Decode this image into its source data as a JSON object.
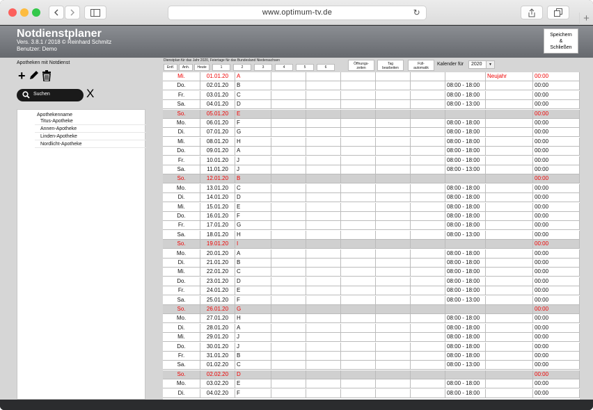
{
  "browser": {
    "url": "www.optimum-tv.de",
    "back_icon": "chevron-left-icon",
    "forward_icon": "chevron-right-icon",
    "sidebar_icon": "sidebar-icon",
    "share_icon": "share-icon",
    "tabs_icon": "tabs-icon",
    "reload_icon": "reload-icon",
    "new_tab_label": "+"
  },
  "app": {
    "title": "Notdienstplaner",
    "version": "Vers. 3.8.1 / 2018 © Reinhard Schmitz",
    "user": "Benutzer: Demo",
    "save_line1": "Speichern",
    "save_line2": "&",
    "save_line3": "Schließen"
  },
  "left": {
    "label": "Apotheken mit  Notdienst",
    "search_placeholder": "Suchen",
    "clear_label": "X",
    "column_header": "Apothekenname",
    "pharmacies": [
      "Titus-Apotheke",
      "Annen-Apotheke",
      "Linden-Apotheke",
      "Nordlicht-Apotheke"
    ]
  },
  "toolbar": {
    "title": "Dienstplan für das Jahr 2020, Feiertage für das Bundesland Niedersachsen",
    "buttons": [
      "Entf.",
      "Anh.",
      "Heute",
      "1",
      "2",
      "3",
      "4",
      "5",
      "6"
    ],
    "opening_line1": "Öffnungs-",
    "opening_line2": "zeiten",
    "edit_line1": "Tag",
    "edit_line2": "bearbeiten",
    "auto_line1": "Füll-",
    "auto_line2": "automatik",
    "calendar_label": "Kalender für",
    "year": "2020"
  },
  "colors": {
    "sunday_row": "#d0d0d0",
    "holiday_text": "#e00000",
    "header": "#7a7d82"
  },
  "rows": [
    {
      "day": "Mi.",
      "date": "01.01.20",
      "code": "A",
      "hours": "",
      "note": "Neujahr",
      "end": "00:00",
      "type": "holiday"
    },
    {
      "day": "Do.",
      "date": "02.01.20",
      "code": "B",
      "hours": "08:00 - 18:00",
      "note": "",
      "end": "00:00",
      "type": "normal"
    },
    {
      "day": "Fr.",
      "date": "03.01.20",
      "code": "C",
      "hours": "08:00 - 18:00",
      "note": "",
      "end": "00:00",
      "type": "normal"
    },
    {
      "day": "Sa.",
      "date": "04.01.20",
      "code": "D",
      "hours": "08:00 - 13:00",
      "note": "",
      "end": "00:00",
      "type": "normal"
    },
    {
      "day": "So.",
      "date": "05.01.20",
      "code": "E",
      "hours": "",
      "note": "",
      "end": "00:00",
      "type": "sunday"
    },
    {
      "day": "Mo.",
      "date": "06.01.20",
      "code": "F",
      "hours": "08:00 - 18:00",
      "note": "",
      "end": "00:00",
      "type": "normal"
    },
    {
      "day": "Di.",
      "date": "07.01.20",
      "code": "G",
      "hours": "08:00 - 18:00",
      "note": "",
      "end": "00:00",
      "type": "normal"
    },
    {
      "day": "Mi.",
      "date": "08.01.20",
      "code": "H",
      "hours": "08:00 - 18:00",
      "note": "",
      "end": "00:00",
      "type": "normal"
    },
    {
      "day": "Do.",
      "date": "09.01.20",
      "code": "A",
      "hours": "08:00 - 18:00",
      "note": "",
      "end": "00:00",
      "type": "normal"
    },
    {
      "day": "Fr.",
      "date": "10.01.20",
      "code": "J",
      "hours": "08:00 - 18:00",
      "note": "",
      "end": "00:00",
      "type": "normal"
    },
    {
      "day": "Sa.",
      "date": "11.01.20",
      "code": "J",
      "hours": "08:00 - 13:00",
      "note": "",
      "end": "00:00",
      "type": "normal"
    },
    {
      "day": "So.",
      "date": "12.01.20",
      "code": "B",
      "hours": "",
      "note": "",
      "end": "00:00",
      "type": "sunday"
    },
    {
      "day": "Mo.",
      "date": "13.01.20",
      "code": "C",
      "hours": "08:00 - 18:00",
      "note": "",
      "end": "00:00",
      "type": "normal"
    },
    {
      "day": "Di.",
      "date": "14.01.20",
      "code": "D",
      "hours": "08:00 - 18:00",
      "note": "",
      "end": "00:00",
      "type": "normal"
    },
    {
      "day": "Mi.",
      "date": "15.01.20",
      "code": "E",
      "hours": "08:00 - 18:00",
      "note": "",
      "end": "00:00",
      "type": "normal"
    },
    {
      "day": "Do.",
      "date": "16.01.20",
      "code": "F",
      "hours": "08:00 - 18:00",
      "note": "",
      "end": "00:00",
      "type": "normal"
    },
    {
      "day": "Fr.",
      "date": "17.01.20",
      "code": "G",
      "hours": "08:00 - 18:00",
      "note": "",
      "end": "00:00",
      "type": "normal"
    },
    {
      "day": "Sa.",
      "date": "18.01.20",
      "code": "H",
      "hours": "08:00 - 13:00",
      "note": "",
      "end": "00:00",
      "type": "normal"
    },
    {
      "day": "So.",
      "date": "19.01.20",
      "code": "I",
      "hours": "",
      "note": "",
      "end": "00:00",
      "type": "sunday"
    },
    {
      "day": "Mo.",
      "date": "20.01.20",
      "code": "A",
      "hours": "08:00 - 18:00",
      "note": "",
      "end": "00:00",
      "type": "normal"
    },
    {
      "day": "Di.",
      "date": "21.01.20",
      "code": "B",
      "hours": "08:00 - 18:00",
      "note": "",
      "end": "00:00",
      "type": "normal"
    },
    {
      "day": "Mi.",
      "date": "22.01.20",
      "code": "C",
      "hours": "08:00 - 18:00",
      "note": "",
      "end": "00:00",
      "type": "normal"
    },
    {
      "day": "Do.",
      "date": "23.01.20",
      "code": "D",
      "hours": "08:00 - 18:00",
      "note": "",
      "end": "00:00",
      "type": "normal"
    },
    {
      "day": "Fr.",
      "date": "24.01.20",
      "code": "E",
      "hours": "08:00 - 18:00",
      "note": "",
      "end": "00:00",
      "type": "normal"
    },
    {
      "day": "Sa.",
      "date": "25.01.20",
      "code": "F",
      "hours": "08:00 - 13:00",
      "note": "",
      "end": "00:00",
      "type": "normal"
    },
    {
      "day": "So.",
      "date": "26.01.20",
      "code": "G",
      "hours": "",
      "note": "",
      "end": "00:00",
      "type": "sunday"
    },
    {
      "day": "Mo.",
      "date": "27.01.20",
      "code": "H",
      "hours": "08:00 - 18:00",
      "note": "",
      "end": "00:00",
      "type": "normal"
    },
    {
      "day": "Di.",
      "date": "28.01.20",
      "code": "A",
      "hours": "08:00 - 18:00",
      "note": "",
      "end": "00:00",
      "type": "normal"
    },
    {
      "day": "Mi.",
      "date": "29.01.20",
      "code": "J",
      "hours": "08:00 - 18:00",
      "note": "",
      "end": "00:00",
      "type": "normal"
    },
    {
      "day": "Do.",
      "date": "30.01.20",
      "code": "J",
      "hours": "08:00 - 18:00",
      "note": "",
      "end": "00:00",
      "type": "normal"
    },
    {
      "day": "Fr.",
      "date": "31.01.20",
      "code": "B",
      "hours": "08:00 - 18:00",
      "note": "",
      "end": "00:00",
      "type": "normal"
    },
    {
      "day": "Sa.",
      "date": "01.02.20",
      "code": "C",
      "hours": "08:00 - 13:00",
      "note": "",
      "end": "00:00",
      "type": "normal"
    },
    {
      "day": "So.",
      "date": "02.02.20",
      "code": "D",
      "hours": "",
      "note": "",
      "end": "00:00",
      "type": "sunday"
    },
    {
      "day": "Mo.",
      "date": "03.02.20",
      "code": "E",
      "hours": "08:00 - 18:00",
      "note": "",
      "end": "00:00",
      "type": "normal"
    },
    {
      "day": "Di.",
      "date": "04.02.20",
      "code": "F",
      "hours": "08:00 - 18:00",
      "note": "",
      "end": "00:00",
      "type": "normal"
    }
  ]
}
